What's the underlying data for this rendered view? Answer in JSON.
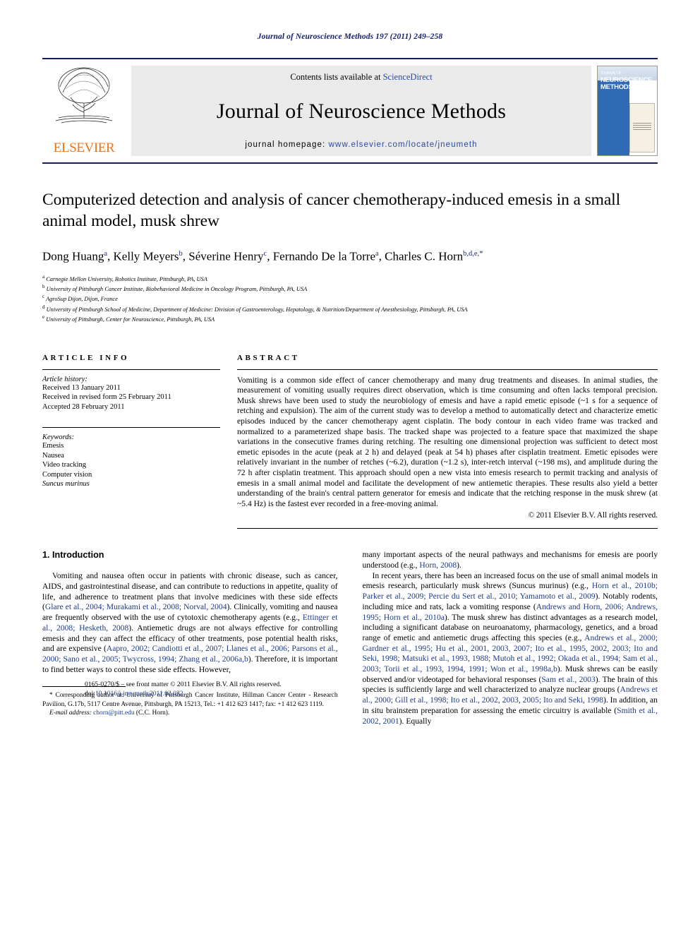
{
  "running_head": "Journal of Neuroscience Methods 197 (2011) 249–258",
  "masthead": {
    "publisher_name": "ELSEVIER",
    "contents_line_prefix": "Contents lists available at ",
    "contents_line_link": "ScienceDirect",
    "journal_title": "Journal of Neuroscience Methods",
    "homepage_label": "journal homepage:",
    "homepage_url": "www.elsevier.com/locate/jneumeth",
    "cover": {
      "line_small": "JOURNAL OF",
      "line1": "NEUROSCIENCE",
      "line2": "METHODS"
    },
    "rule_color": "#14205f",
    "link_color": "#2b4a9b",
    "logo_color": "#e8741b"
  },
  "article": {
    "title": "Computerized detection and analysis of cancer chemotherapy-induced emesis in a small animal model, musk shrew",
    "authors_html": "Dong Huang<sup>a</sup>, Kelly Meyers<sup>b</sup>, Séverine Henry<sup>c</sup>, Fernando De la Torre<sup>a</sup>, Charles C. Horn<sup>b,d,e,<span>*</span></sup>",
    "affiliations": [
      {
        "marker": "a",
        "text": "Carnegie Mellon University, Robotics Institute, Pittsburgh, PA, USA"
      },
      {
        "marker": "b",
        "text": "University of Pittsburgh Cancer Institute, Biobehavioral Medicine in Oncology Program, Pittsburgh, PA, USA"
      },
      {
        "marker": "c",
        "text": "AgroSup Dijon, Dijon, France"
      },
      {
        "marker": "d",
        "text": "University of Pittsburgh School of Medicine, Department of Medicine: Division of Gastroenterology, Hepatology, & Nutrition/Department of Anesthesiology, Pittsburgh, PA, USA"
      },
      {
        "marker": "e",
        "text": "University of Pittsburgh, Center for Neuroscience, Pittsburgh, PA, USA"
      }
    ]
  },
  "article_info": {
    "heading": "ARTICLE INFO",
    "history_label": "Article history:",
    "history": [
      "Received 13 January 2011",
      "Received in revised form 25 February 2011",
      "Accepted 28 February 2011"
    ],
    "keywords_label": "Keywords:",
    "keywords": [
      {
        "text": "Emesis",
        "italic": false
      },
      {
        "text": "Nausea",
        "italic": false
      },
      {
        "text": "Video tracking",
        "italic": false
      },
      {
        "text": "Computer vision",
        "italic": false
      },
      {
        "text": "Suncus murinus",
        "italic": true
      }
    ]
  },
  "abstract": {
    "heading": "ABSTRACT",
    "text": "Vomiting is a common side effect of cancer chemotherapy and many drug treatments and diseases. In animal studies, the measurement of vomiting usually requires direct observation, which is time consuming and often lacks temporal precision. Musk shrews have been used to study the neurobiology of emesis and have a rapid emetic episode (~1 s for a sequence of retching and expulsion). The aim of the current study was to develop a method to automatically detect and characterize emetic episodes induced by the cancer chemotherapy agent cisplatin. The body contour in each video frame was tracked and normalized to a parameterized shape basis. The tracked shape was projected to a feature space that maximized the shape variations in the consecutive frames during retching. The resulting one dimensional projection was sufficient to detect most emetic episodes in the acute (peak at 2 h) and delayed (peak at 54 h) phases after cisplatin treatment. Emetic episodes were relatively invariant in the number of retches (~6.2), duration (~1.2 s), inter-retch interval (~198 ms), and amplitude during the 72 h after cisplatin treatment. This approach should open a new vista into emesis research to permit tracking and analysis of emesis in a small animal model and facilitate the development of new antiemetic therapies. These results also yield a better understanding of the brain's central pattern generator for emesis and indicate that the retching response in the musk shrew (at ~5.4 Hz) is the fastest ever recorded in a free-moving animal.",
    "copyright": "© 2011 Elsevier B.V. All rights reserved."
  },
  "introduction": {
    "heading": "1. Introduction",
    "left_para_1_a": "Vomiting and nausea often occur in patients with chronic disease, such as cancer, AIDS, and gastrointestinal disease, and can contribute to reductions in appetite, quality of life, and adherence to treatment plans that involve medicines with these side effects (",
    "left_cite_1": "Glare et al., 2004; Murakami et al., 2008; Norval, 2004",
    "left_para_1_b": "). Clinically, vomiting and nausea are frequently observed with the use of cytotoxic chemotherapy agents (e.g., ",
    "left_cite_2": "Ettinger et al., 2008; Hesketh, 2008",
    "left_para_1_c": "). Antiemetic drugs are not always effective for controlling emesis and they can affect the efficacy of other treatments, pose potential health risks, and are expensive (",
    "left_cite_3": "Aapro, 2002; Candiotti et al., 2007; Llanes et al., 2006; Parsons et al., 2000; Sano et al., 2005; Twycross, 1994; Zhang et al., 2006a,b",
    "left_para_1_d": "). Therefore, it is important to find better ways to control these side effects. However,",
    "right_para_1_a": "many important aspects of the neural pathways and mechanisms for emesis are poorly understood (e.g., ",
    "right_cite_1": "Horn, 2008",
    "right_para_1_b": ").",
    "right_para_2_a": "In recent years, there has been an increased focus on the use of small animal models in emesis research, particularly musk shrews (Suncus murinus) (e.g., ",
    "right_cite_2": "Horn et al., 2010b; Parker et al., 2009; Percie du Sert et al., 2010; Yamamoto et al., 2009",
    "right_para_2_b": "). Notably rodents, including mice and rats, lack a vomiting response (",
    "right_cite_3": "Andrews and Horn, 2006; Andrews, 1995; Horn et al., 2010a",
    "right_para_2_c": "). The musk shrew has distinct advantages as a research model, including a significant database on neuroanatomy, pharmacology, genetics, and a broad range of emetic and antiemetic drugs affecting this species (e.g., ",
    "right_cite_4": "Andrews et al., 2000; Gardner et al., 1995; Hu et al., 2001, 2003, 2007; Ito et al., 1995, 2002, 2003; Ito and Seki, 1998; Matsuki et al., 1993, 1988; Mutoh et al., 1992; Okada et al., 1994; Sam et al., 2003; Torii et al., 1993, 1994, 1991; Won et al., 1998a,b",
    "right_para_2_d": "). Musk shrews can be easily observed and/or videotaped for behavioral responses (",
    "right_cite_5": "Sam et al., 2003",
    "right_para_2_e": "). The brain of this species is sufficiently large and well characterized to analyze nuclear groups (",
    "right_cite_6": "Andrews et al., 2000; Gill et al., 1998; Ito et al., 2002, 2003, 2005; Ito and Seki, 1998",
    "right_para_2_f": "). In addition, an in situ brainstem preparation for assessing the emetic circuitry is available (",
    "right_cite_7": "Smith et al., 2002, 2001",
    "right_para_2_g": "). Equally"
  },
  "footnote": {
    "corresponding_marker": "*",
    "corresponding_text": "Corresponding author at: University of Pittsburgh Cancer Institute, Hillman Cancer Center - Research Pavilion, G.17b, 5117 Centre Avenue, Pittsburgh, PA 15213, Tel.: +1 412 623 1417; fax: +1 412 623 1119.",
    "email_label": "E-mail address:",
    "email": "chorn@pitt.edu",
    "email_owner": "(C.C. Horn)."
  },
  "imprint": {
    "issn_line": "0165-0270/$ – see front matter © 2011 Elsevier B.V. All rights reserved.",
    "doi_prefix": "doi:",
    "doi": "10.1016/j.jneumeth.2011.02.032"
  }
}
